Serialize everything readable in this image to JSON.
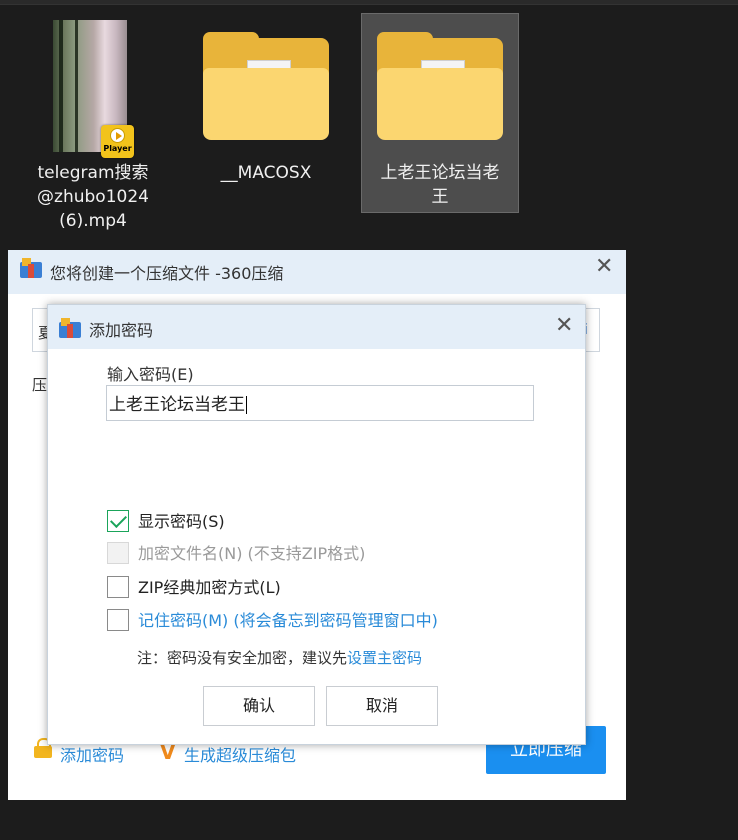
{
  "explorer": {
    "files": [
      {
        "name_line1": "telegram搜索",
        "name_line2": "@zhubo1024",
        "name_line3": "(6).mp4",
        "badge": "Player"
      },
      {
        "name": "__MACOSX"
      },
      {
        "name_line1": "上老王论坛当老",
        "name_line2": "王"
      }
    ]
  },
  "main_dialog": {
    "title": "您将创建一个压缩文件 -360压缩",
    "close": "✕",
    "input_partial_char": "夏",
    "input_tail_char": "i",
    "label_partial": "压",
    "footer": {
      "add_password_link": "添加密码",
      "super_pack_link": "生成超级压缩包",
      "compress_button": "立即压缩"
    },
    "colors": {
      "accent": "#1a8ff0",
      "link": "#2a8bd8",
      "title_bar": "#e4eef8"
    }
  },
  "password_dialog": {
    "title": "添加密码",
    "close": "✕",
    "input_label": "输入密码(E)",
    "input_value": "上老王论坛当老王",
    "options": {
      "show_password": {
        "label": "显示密码(S)",
        "checked": true
      },
      "encrypt_filename": {
        "label": "加密文件名(N) (不支持ZIP格式)",
        "checked": false,
        "disabled": true
      },
      "zip_classic": {
        "label": "ZIP经典加密方式(L)",
        "checked": false
      },
      "remember_password": {
        "label": "记住密码(M) (将会备忘到密码管理窗口中)",
        "checked": false
      }
    },
    "note_text": "注：密码没有安全加密，建议先",
    "note_link": "设置主密码",
    "ok_button": "确认",
    "cancel_button": "取消"
  }
}
